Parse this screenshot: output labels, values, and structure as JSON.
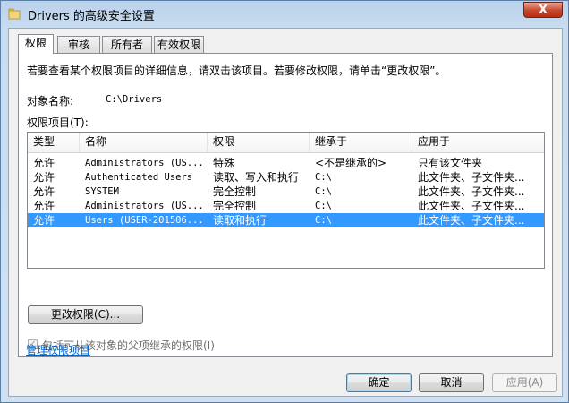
{
  "window": {
    "title": "Drivers 的高级安全设置",
    "close_symbol": "X"
  },
  "tabs": [
    {
      "label": "权限",
      "active": true
    },
    {
      "label": "审核",
      "active": false
    },
    {
      "label": "所有者",
      "active": false
    },
    {
      "label": "有效权限",
      "active": false
    }
  ],
  "panel": {
    "instruction": "若要查看某个权限项目的详细信息，请双击该项目。若要修改权限，请单击“更改权限”。",
    "object_name_label": "对象名称:",
    "object_name_value": "C:\\Drivers",
    "entries_label": "权限项目(T):"
  },
  "list": {
    "columns": [
      "类型",
      "名称",
      "权限",
      "继承于",
      "应用于"
    ],
    "rows": [
      {
        "type": "允许",
        "name": "Administrators (US...",
        "permission": "特殊",
        "inherited_from": "<不是继承的>",
        "applies_to": "只有该文件夹",
        "selected": false
      },
      {
        "type": "允许",
        "name": "Authenticated Users",
        "permission": "读取、写入和执行",
        "inherited_from": "C:\\",
        "applies_to": "此文件夹、子文件夹...",
        "selected": false
      },
      {
        "type": "允许",
        "name": "SYSTEM",
        "permission": "完全控制",
        "inherited_from": "C:\\",
        "applies_to": "此文件夹、子文件夹...",
        "selected": false
      },
      {
        "type": "允许",
        "name": "Administrators (US...",
        "permission": "完全控制",
        "inherited_from": "C:\\",
        "applies_to": "此文件夹、子文件夹...",
        "selected": false
      },
      {
        "type": "允许",
        "name": "Users (USER-201506...",
        "permission": "读取和执行",
        "inherited_from": "C:\\",
        "applies_to": "此文件夹、子文件夹...",
        "selected": true
      }
    ]
  },
  "buttons": {
    "change_permissions": "更改权限(C)...",
    "ok": "确定",
    "cancel": "取消",
    "apply": "应用(A)"
  },
  "inherit_checkbox": {
    "label": "包括可从该对象的父项继承的权限(I)",
    "checked": true,
    "disabled": true
  },
  "manage_link": "管理权限项目",
  "colors": {
    "selection": "#3399ff",
    "link": "#0066cc"
  }
}
